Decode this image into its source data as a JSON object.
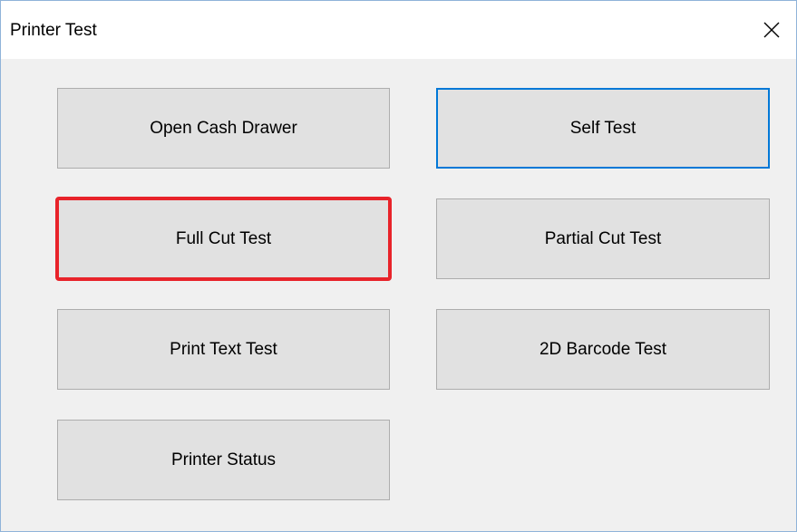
{
  "window": {
    "title": "Printer Test",
    "close_label": "Close"
  },
  "buttons": {
    "open_cash_drawer": "Open Cash Drawer",
    "self_test": "Self Test",
    "full_cut_test": "Full Cut Test",
    "partial_cut_test": "Partial Cut Test",
    "print_text_test": "Print Text Test",
    "barcode_2d_test": "2D Barcode Test",
    "printer_status": "Printer Status"
  },
  "colors": {
    "focus_border": "#0078d7",
    "highlight_border": "#e8232a",
    "button_face": "#e1e1e1",
    "dialog_background": "#f0f0f0"
  },
  "icons": {
    "close": "close-icon"
  }
}
